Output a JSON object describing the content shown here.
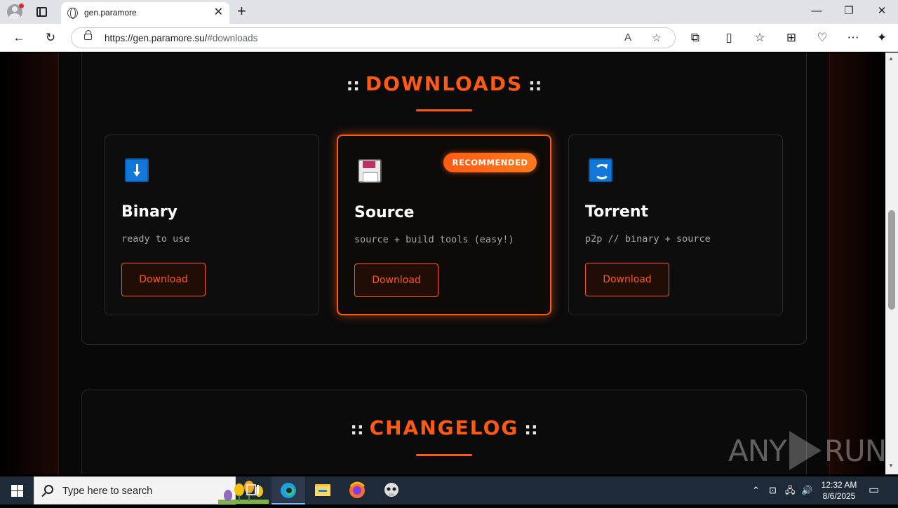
{
  "browser": {
    "tab_title": "gen.paramore",
    "url_host": "https://gen.paramore.su/",
    "url_hash": "#downloads"
  },
  "downloads": {
    "title": "DOWNLOADS",
    "deco": "::",
    "cards": [
      {
        "icon": "download-arrow-icon",
        "name": "Binary",
        "desc": "ready to use",
        "button": "Download"
      },
      {
        "icon": "floppy-disk-icon",
        "name": "Source",
        "desc": "source + build tools (easy!)",
        "button": "Download",
        "badge": "RECOMMENDED"
      },
      {
        "icon": "refresh-icon",
        "name": "Torrent",
        "desc": "p2p // binary + source",
        "button": "Download"
      }
    ]
  },
  "changelog": {
    "title": "CHANGELOG",
    "deco": "::"
  },
  "watermark": {
    "left": "ANY",
    "right": "RUN"
  },
  "taskbar": {
    "search_placeholder": "Type here to search",
    "time": "12:32 AM",
    "date": "8/6/2025"
  },
  "colors": {
    "accent": "#ff5a14",
    "page_bg": "#050505",
    "card_bg": "#0d0d0d"
  }
}
